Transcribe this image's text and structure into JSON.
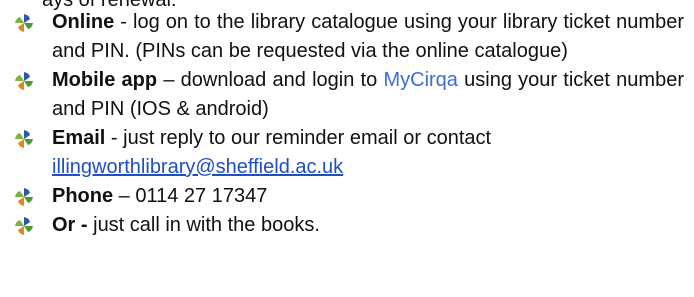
{
  "top_line": "ays of renewal:",
  "items": [
    {
      "icon": "pinwheel-bullet-icon",
      "lead": "Online",
      "text": " - log on to the library catalogue using your library ticket number and PIN. (PINs can be requested via the online catalogue)"
    },
    {
      "icon": "pinwheel-bullet-icon",
      "lead": "Mobile app",
      "pre": " – download and login to ",
      "link": "MyCirqa",
      "post": " using your ticket number and PIN (IOS & android)"
    },
    {
      "icon": "pinwheel-bullet-icon",
      "lead": "Email",
      "pre": " - just reply to our reminder email or contact ",
      "link": "illingworthlibrary@sheffield.ac.uk"
    },
    {
      "icon": "pinwheel-bullet-icon",
      "lead": "Phone",
      "text": " – 0114 27 17347"
    },
    {
      "icon": "pinwheel-bullet-icon",
      "lead": "Or -",
      "text": " just call in with the books."
    }
  ],
  "colors": {
    "text": "#111111",
    "link_app": "#3b6fd6",
    "link_email": "#1f4fc2",
    "bullet_blue": "#2c5aa0",
    "bullet_green": "#4a9a3a",
    "bullet_orange": "#e08a1e"
  }
}
